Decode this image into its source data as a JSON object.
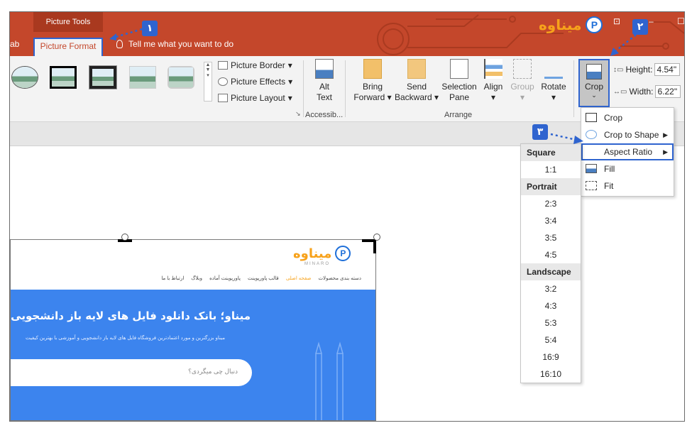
{
  "titlebar": {
    "contextual_tab": "Picture Tools",
    "cut_tab": "ab",
    "active_tab": "Picture Format",
    "tell_me": "Tell me what you want to do",
    "logo_text": "میناوه",
    "logo_mark": "P"
  },
  "ribbon": {
    "picture_menu": [
      "Picture Border",
      "Picture Effects",
      "Picture Layout"
    ],
    "alt_text": [
      "Alt",
      "Text"
    ],
    "accessibility_label": "Accessib...",
    "arrange_buttons": [
      {
        "line1": "Bring",
        "line2": "Forward"
      },
      {
        "line1": "Send",
        "line2": "Backward"
      },
      {
        "line1": "Selection",
        "line2": "Pane"
      },
      {
        "line1": "Align",
        "line2": ""
      },
      {
        "line1": "Group",
        "line2": ""
      },
      {
        "line1": "Rotate",
        "line2": ""
      }
    ],
    "arrange_label": "Arrange",
    "crop_label": "Crop",
    "height_label": "Height:",
    "height_value": "4.54\"",
    "width_label": "Width:",
    "width_value": "6.22\""
  },
  "crop_menu": [
    {
      "label": "Crop",
      "icon": "crop-icon",
      "arrow": ""
    },
    {
      "label": "Crop to Shape",
      "icon": "shape-icon",
      "arrow": "▶"
    },
    {
      "label": "Aspect Ratio",
      "icon": "",
      "arrow": "▶"
    },
    {
      "label": "Fill",
      "icon": "fill-icon",
      "arrow": ""
    },
    {
      "label": "Fit",
      "icon": "fit-icon",
      "arrow": ""
    }
  ],
  "aspect_menu": {
    "square_head": "Square",
    "square": [
      "1:1"
    ],
    "portrait_head": "Portrait",
    "portrait": [
      "2:3",
      "3:4",
      "3:5",
      "4:5"
    ],
    "landscape_head": "Landscape",
    "landscape": [
      "3:2",
      "4:3",
      "5:3",
      "5:4",
      "16:9",
      "16:10"
    ]
  },
  "badges": [
    "١",
    "٢",
    "٣"
  ],
  "picture": {
    "logo_word": "میناوه",
    "logo_mark": "P",
    "logo_sub": "MINARO",
    "nav": [
      "دسته بندی محصولات",
      "صفحه اصلی",
      "قالب پاورپوینت",
      "پاورپوینت آماده",
      "وبلاگ",
      "ارتباط با ما"
    ],
    "headline": "میناو؛ بانک دانلود فایل های لایه باز دانشجویی و آمو",
    "description": "میناو بزرگترین و مورد اعتمادترین فروشگاه فایل های لایه باز دانشجویی و آموزشی با بهترین کیفیت",
    "search_placeholder": "دنبال چی میگردی؟"
  },
  "colors": {
    "accent": "#c4472b",
    "highlight": "#2f64cf",
    "site_blue": "#3c84ee",
    "logo_orange": "#f7a21b"
  }
}
